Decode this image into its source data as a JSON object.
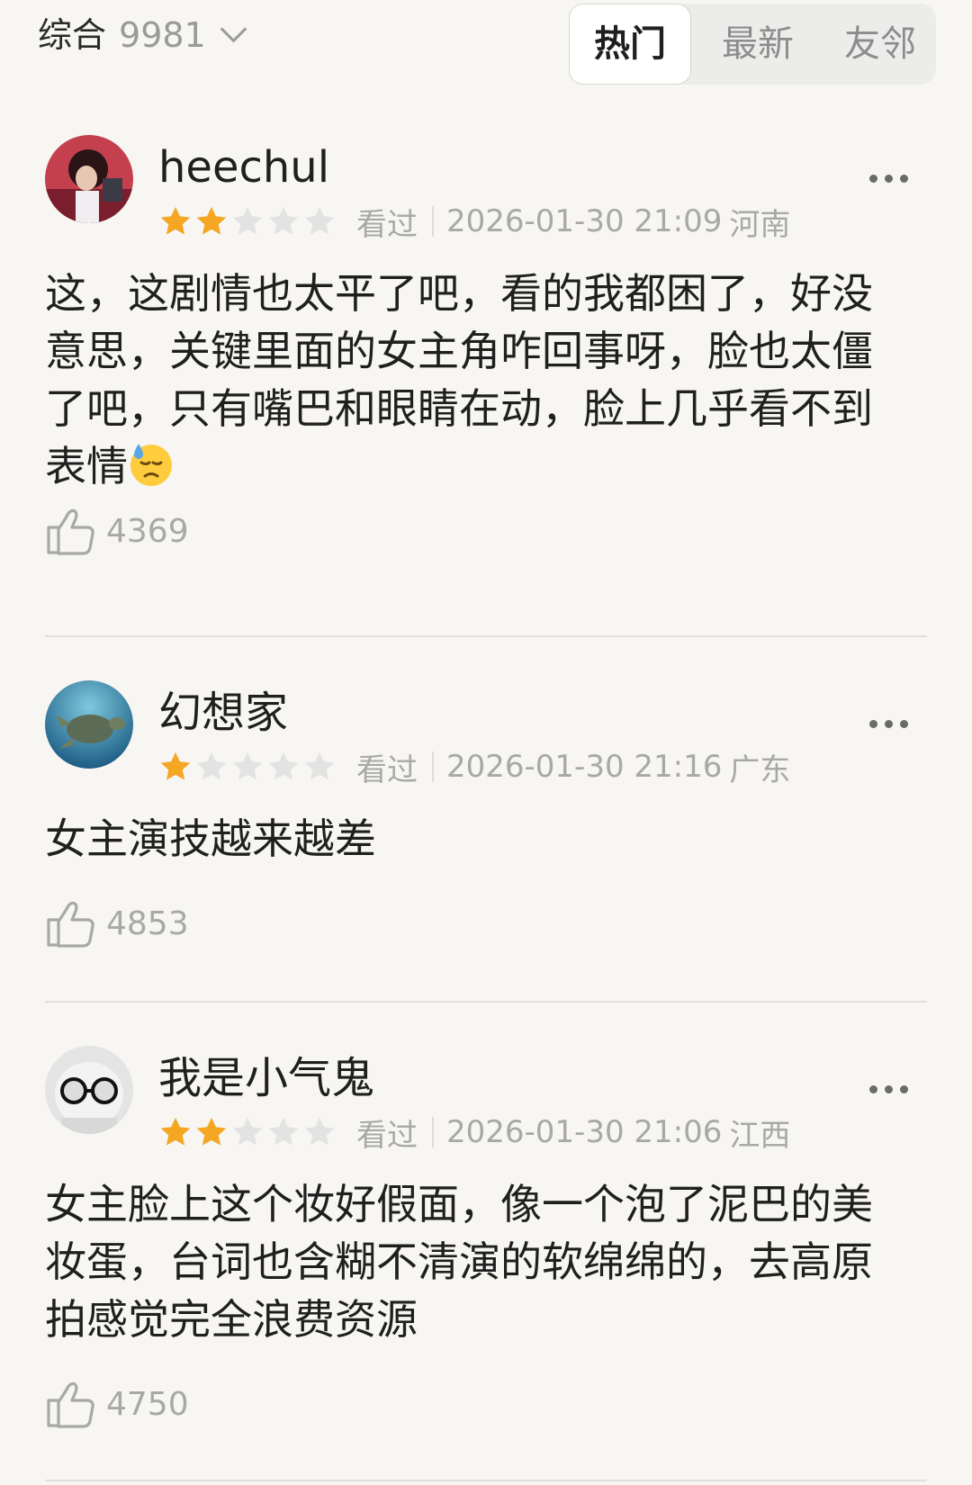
{
  "header": {
    "sort_label": "综合",
    "count": "9981",
    "tabs": [
      {
        "label": "热门",
        "active": true
      },
      {
        "label": "最新",
        "active": false
      },
      {
        "label": "友邻",
        "active": false
      }
    ]
  },
  "comments": [
    {
      "user": "heechul",
      "rating": 2,
      "status": "看过",
      "datetime": "2026-01-30 21:09",
      "region": "河南",
      "text": "这，这剧情也太平了吧，看的我都困了，好没意思，关键里面的女主角咋回事呀，脸也太僵了吧，只有嘴巴和眼睛在动，脸上几乎看不到表情",
      "emoji": "downcast-sweat-face-emoji",
      "likes": "4369"
    },
    {
      "user": "幻想家",
      "rating": 1,
      "status": "看过",
      "datetime": "2026-01-30 21:16",
      "region": "广东",
      "text": "女主演技越来越差",
      "likes": "4853"
    },
    {
      "user": "我是小气鬼",
      "rating": 2,
      "status": "看过",
      "datetime": "2026-01-30 21:06",
      "region": "江西",
      "text": "女主脸上这个妆好假面，像一个泡了泥巴的美妆蛋，台词也含糊不清演的软绵绵的，去高原拍感觉完全浪费资源",
      "likes": "4750"
    }
  ],
  "colors": {
    "background": "#f7f6f2",
    "star_filled": "#f5a623",
    "star_empty": "#e3e3e3",
    "muted_text": "#a8a8a8"
  }
}
